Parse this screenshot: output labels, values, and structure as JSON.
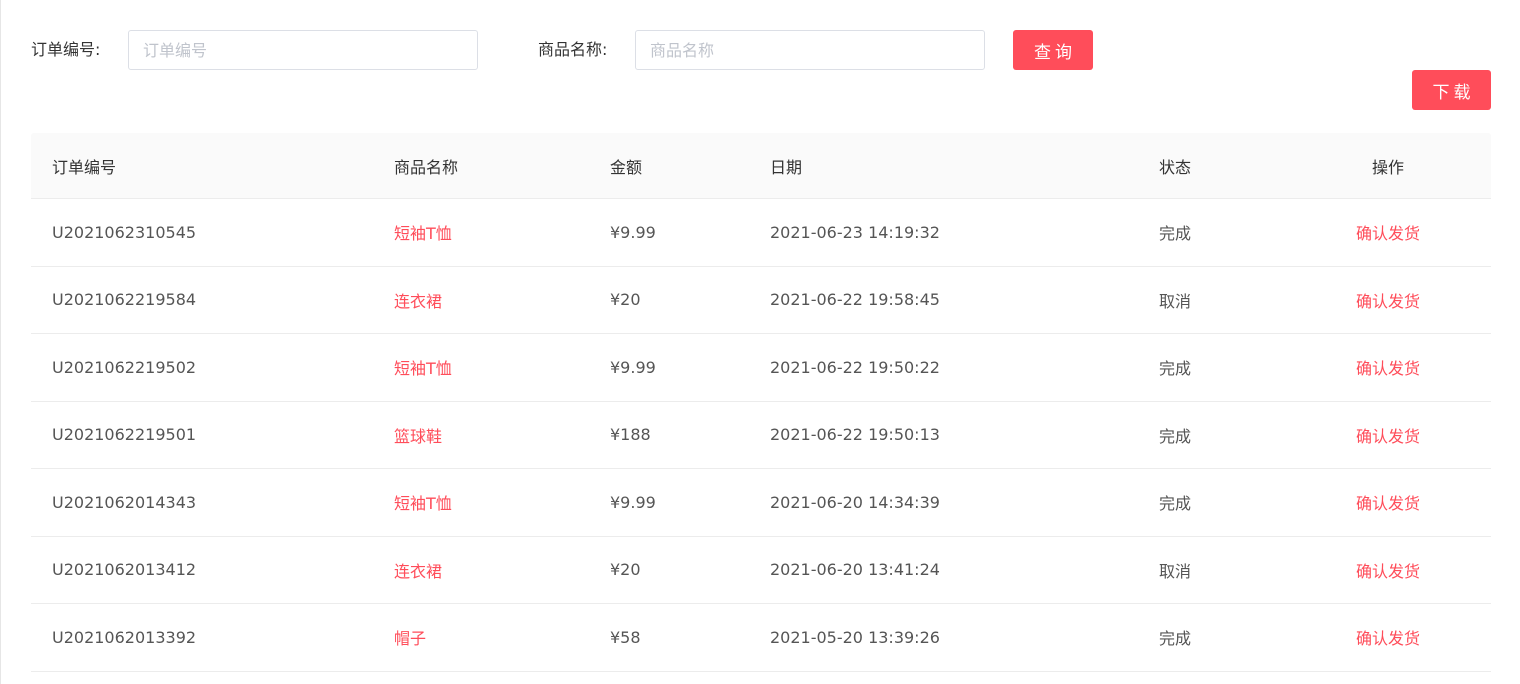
{
  "filters": {
    "order_label": "订单编号:",
    "order_placeholder": "订单编号",
    "order_value": "",
    "product_label": "商品名称:",
    "product_placeholder": "商品名称",
    "product_value": "",
    "query_button": "查询",
    "download_button": "下载"
  },
  "colors": {
    "accent": "#ff4d5a",
    "header_bg": "#fafafa",
    "border": "#ececec"
  },
  "table": {
    "headers": {
      "order": "订单编号",
      "product": "商品名称",
      "amount": "金额",
      "date": "日期",
      "status": "状态",
      "action": "操作"
    },
    "rows": [
      {
        "order": "U2021062310545",
        "product": "短袖T恤",
        "amount": "¥9.99",
        "date": "2021-06-23 14:19:32",
        "status": "完成",
        "action": "确认发货"
      },
      {
        "order": "U2021062219584",
        "product": "连衣裙",
        "amount": "¥20",
        "date": "2021-06-22 19:58:45",
        "status": "取消",
        "action": "确认发货"
      },
      {
        "order": "U2021062219502",
        "product": "短袖T恤",
        "amount": "¥9.99",
        "date": "2021-06-22 19:50:22",
        "status": "完成",
        "action": "确认发货"
      },
      {
        "order": "U2021062219501",
        "product": "篮球鞋",
        "amount": "¥188",
        "date": "2021-06-22 19:50:13",
        "status": "完成",
        "action": "确认发货"
      },
      {
        "order": "U2021062014343",
        "product": "短袖T恤",
        "amount": "¥9.99",
        "date": "2021-06-20 14:34:39",
        "status": "完成",
        "action": "确认发货"
      },
      {
        "order": "U2021062013412",
        "product": "连衣裙",
        "amount": "¥20",
        "date": "2021-06-20 13:41:24",
        "status": "取消",
        "action": "确认发货"
      },
      {
        "order": "U2021062013392",
        "product": "帽子",
        "amount": "¥58",
        "date": "2021-05-20 13:39:26",
        "status": "完成",
        "action": "确认发货"
      }
    ]
  }
}
